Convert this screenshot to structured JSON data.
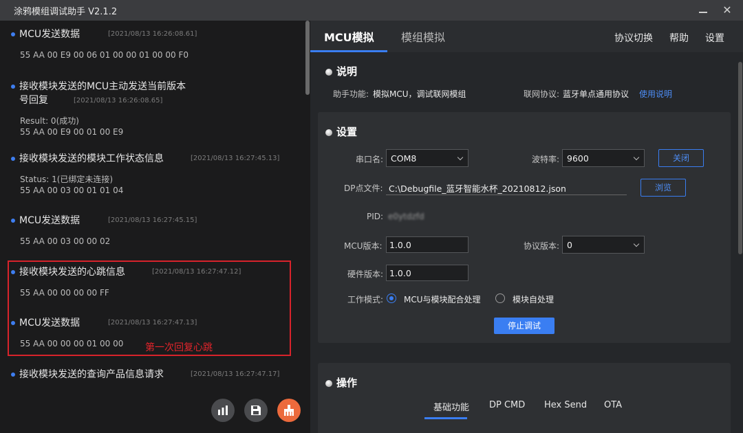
{
  "window": {
    "title": "涂鸦模组调试助手 V2.1.2",
    "minimize": "—",
    "close": "✕"
  },
  "log": {
    "messages": [
      {
        "title": "MCU发送数据",
        "time": "[2021/08/13 16:26:08.61]",
        "lines": [
          "55 AA 00 E9 00 06 01 00 00 01 00 00 F0"
        ]
      },
      {
        "title": "接收模块发送的MCU主动发送当前版本",
        "title2": "号回复",
        "time": "[2021/08/13 16:26:08.65]",
        "lines": [
          "Result: 0(成功)",
          "55 AA 00 E9 00 01 00 E9"
        ]
      },
      {
        "title": "接收模块发送的模块工作状态信息",
        "time": "[2021/08/13 16:27:45.13]",
        "lines": [
          "Status: 1(已绑定未连接)",
          "55 AA 00 03 00 01 01 04"
        ]
      },
      {
        "title": "MCU发送数据",
        "time": "[2021/08/13 16:27:45.15]",
        "lines": [
          "55 AA 00 03 00 00 02"
        ]
      },
      {
        "title": "接收模块发送的心跳信息",
        "time": "[2021/08/13 16:27:47.12]",
        "lines": [
          "55 AA 00 00 00 00 FF"
        ]
      },
      {
        "title": "MCU发送数据",
        "time": "[2021/08/13 16:27:47.13]",
        "lines": [
          "55 AA 00 00 00 01 00 00"
        ]
      },
      {
        "title": "接收模块发送的查询产品信息请求",
        "time": "[2021/08/13 16:27:47.17]",
        "lines": []
      }
    ],
    "annotation": "第一次回复心跳"
  },
  "tabs": {
    "mcu": "MCU模拟",
    "module": "模组模拟"
  },
  "menu": {
    "protocol_switch": "协议切换",
    "help": "帮助",
    "settings": "设置"
  },
  "intro": {
    "title": "说明",
    "function_label": "助手功能:",
    "function_value": "模拟MCU，调试联网模组",
    "protocol_label": "联网协议:",
    "protocol_value": "蓝牙单点通用协议",
    "usage_link": "使用说明"
  },
  "settings": {
    "title": "设置",
    "port_label": "串口名:",
    "port_value": "COM8",
    "baud_label": "波特率:",
    "baud_value": "9600",
    "close_button": "关闭",
    "dp_label": "DP点文件:",
    "dp_value": "C:\\Debugfile_蓝牙智能水杯_20210812.json",
    "browse_button": "浏览",
    "pid_label": "PID:",
    "pid_value": "e0ytdzfd",
    "mcu_version_label": "MCU版本:",
    "mcu_version_value": "1.0.0",
    "protocol_version_label": "协议版本:",
    "protocol_version_value": "0",
    "hw_version_label": "硬件版本:",
    "hw_version_value": "1.0.0",
    "mode_label": "工作模式:",
    "mode_option1": "MCU与模块配合处理",
    "mode_option2": "模块自处理",
    "stop_button": "停止调试"
  },
  "operation": {
    "title": "操作",
    "tabs": [
      "基础功能",
      "DP CMD",
      "Hex Send",
      "OTA"
    ]
  },
  "colors": {
    "accent": "#3a7ef2",
    "highlight": "#d9232b",
    "fab_orange": "#ec6a3c"
  }
}
